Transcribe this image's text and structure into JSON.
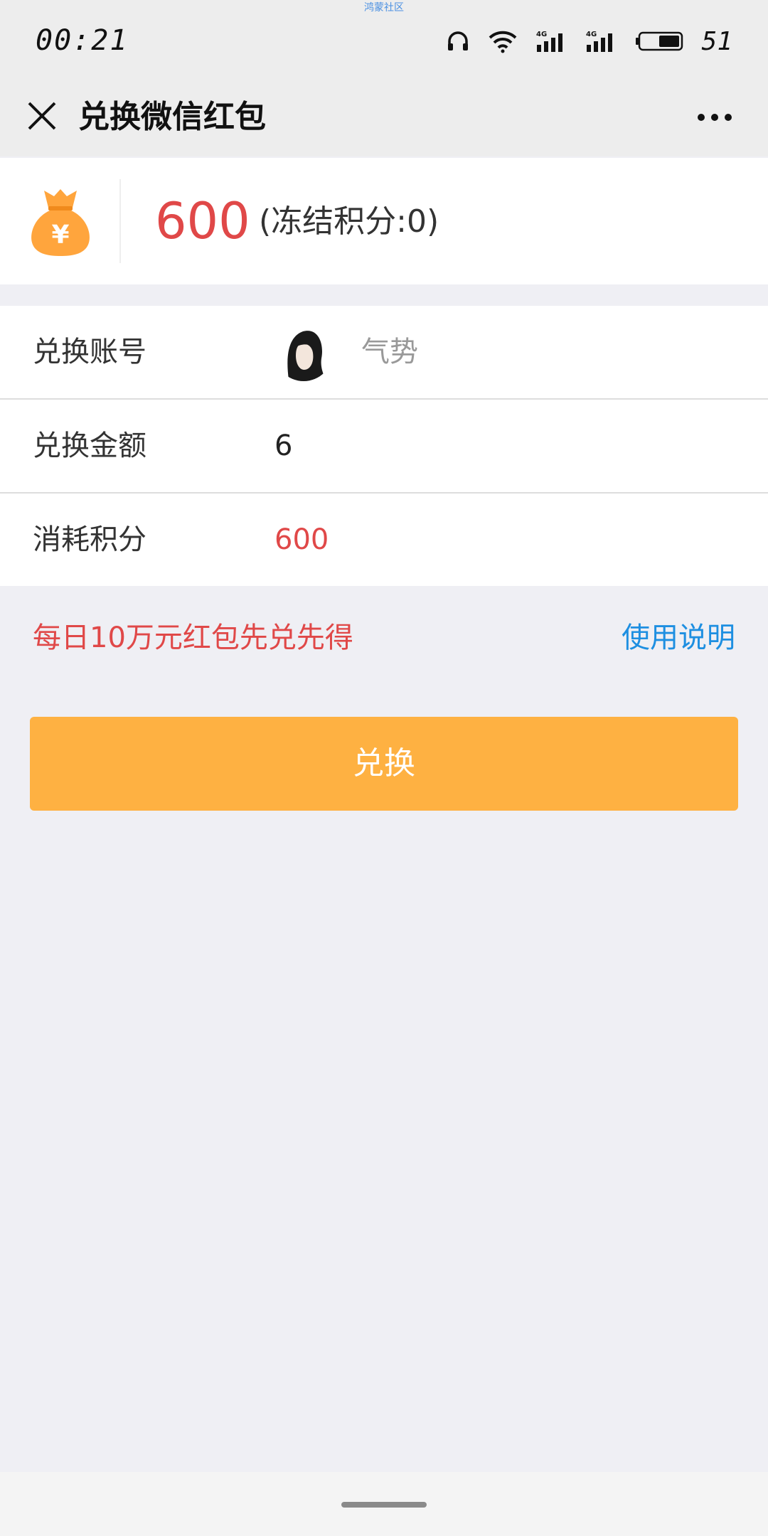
{
  "status_bar": {
    "watermark": "鸿蒙社区",
    "time": "00:21",
    "network_label_1": "4G",
    "network_label_2": "4G",
    "battery_level": "51",
    "icons": [
      "headphones-icon",
      "wifi-icon",
      "signal-4g-icon",
      "signal-4g-icon",
      "battery-icon"
    ]
  },
  "nav": {
    "title": "兑换微信红包",
    "close_icon": "close-icon",
    "more_icon": "more-icon"
  },
  "points": {
    "value": "600",
    "frozen": "(冻结积分:0)",
    "icon": "money-bag-icon",
    "icon_color": "#FFA53D",
    "value_color": "#E04848"
  },
  "form": {
    "account_label": "兑换账号",
    "account_name": "气势",
    "amount_label": "兑换金额",
    "amount_value": "6",
    "cost_label": "消耗积分",
    "cost_value": "600"
  },
  "notice": {
    "text": "每日10万元红包先兑先得",
    "help_link": "使用说明",
    "text_color": "#E04848",
    "link_color": "#1E8FE1"
  },
  "action": {
    "exchange_label": "兑换",
    "button_color": "#FEB142"
  }
}
